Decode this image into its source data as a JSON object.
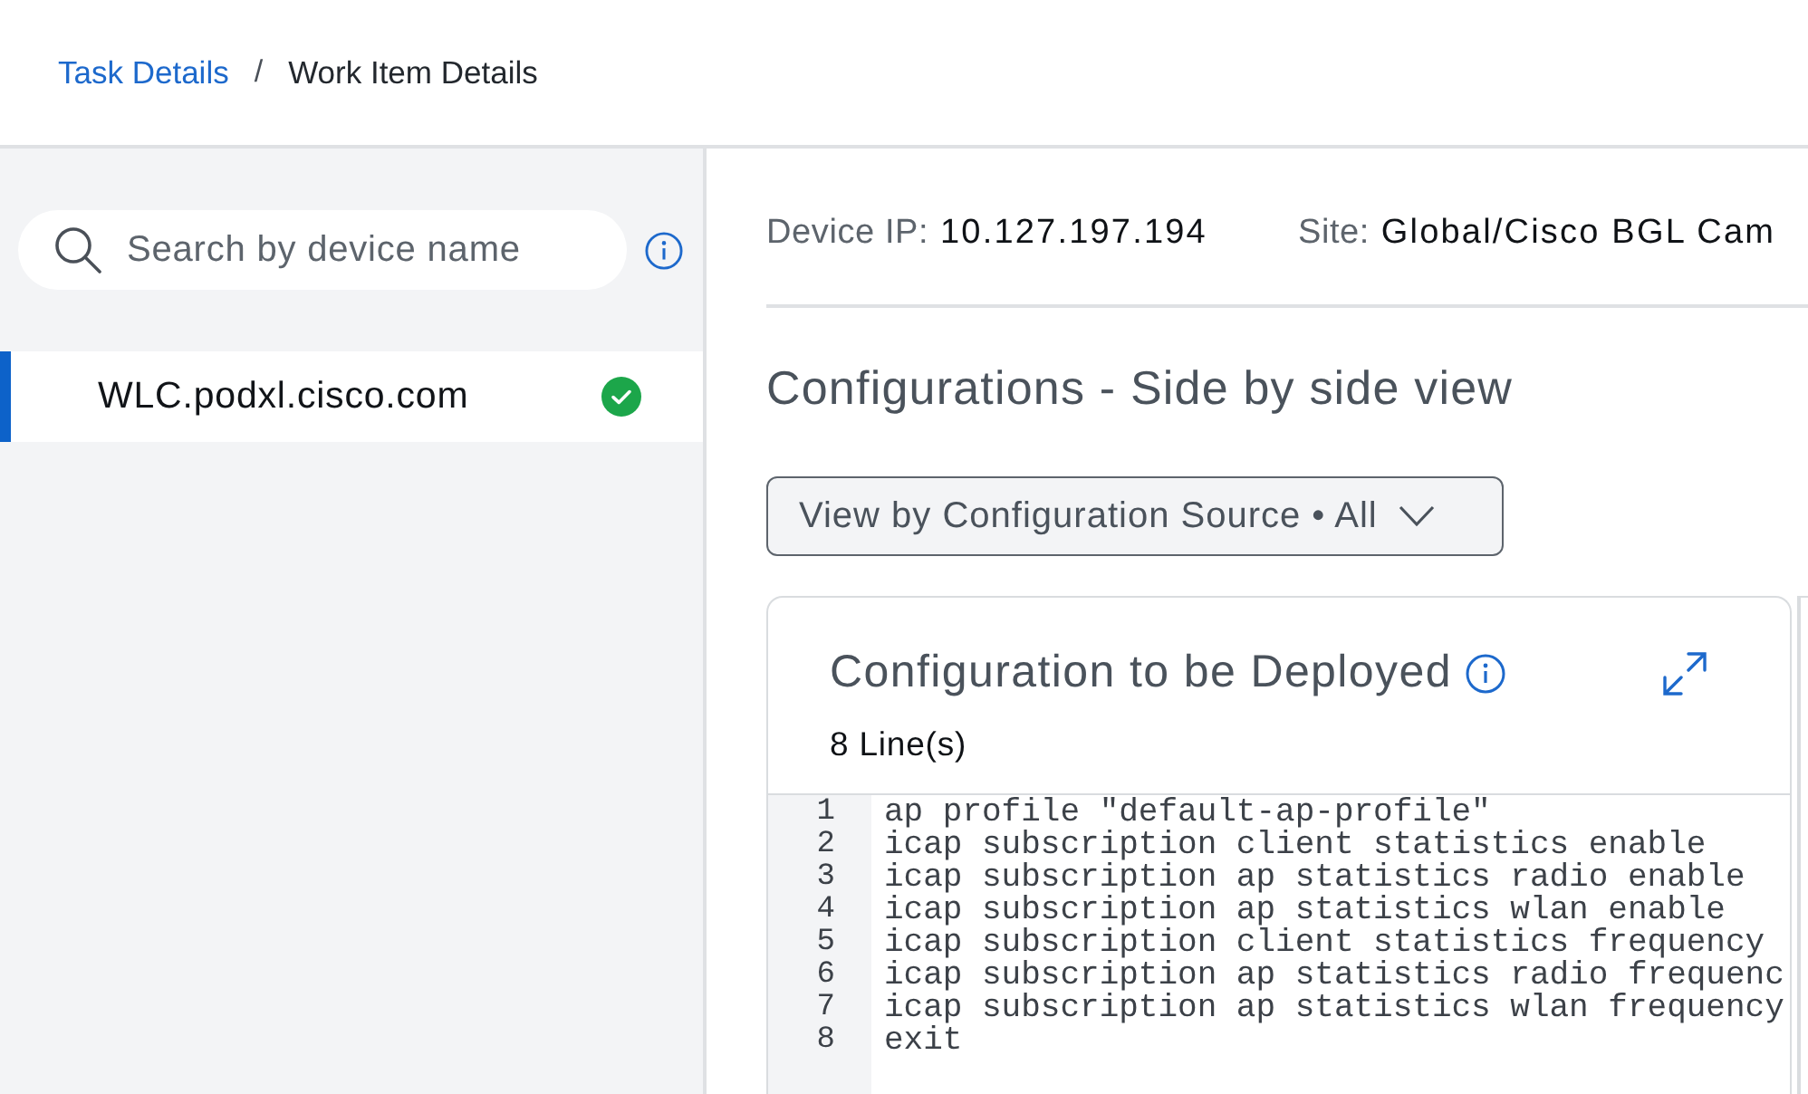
{
  "breadcrumb": {
    "separator": "/",
    "items": [
      {
        "label": "Task Details",
        "kind": "link"
      },
      {
        "label": "Work Item Details",
        "kind": "current"
      }
    ]
  },
  "sidebar": {
    "search": {
      "placeholder": "Search by device name"
    },
    "devices": [
      {
        "name": "WLC.podxl.cisco.com",
        "selected": true,
        "completed": true
      }
    ]
  },
  "device_info": [
    {
      "label": "Device IP:",
      "value": "10.127.197.194"
    },
    {
      "label": "Site:",
      "value": "Global/Cisco BGL Cam"
    }
  ],
  "section_title": "Configurations - Side by side view",
  "filter_button": {
    "label": "View by Configuration Source • All"
  },
  "config_panel": {
    "title": "Configuration to be Deployed",
    "line_count": "8 Line(s)",
    "lines": [
      {
        "number": "1",
        "text": "ap profile \"default-ap-profile\""
      },
      {
        "number": "2",
        "text": "icap subscription client statistics enable"
      },
      {
        "number": "3",
        "text": "icap subscription ap statistics radio enable"
      },
      {
        "number": "4",
        "text": "icap subscription ap statistics wlan enable"
      },
      {
        "number": "5",
        "text": "icap subscription client statistics frequency"
      },
      {
        "number": "6",
        "text": "icap subscription ap statistics radio frequenc"
      },
      {
        "number": "7",
        "text": "icap subscription ap statistics wlan frequency"
      },
      {
        "number": "8",
        "text": "exit"
      }
    ]
  }
}
